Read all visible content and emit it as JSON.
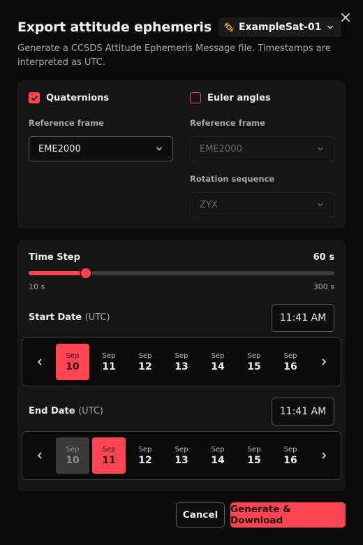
{
  "dialog": {
    "title": "Export attitude ephemeris",
    "satellite": "ExampleSat-01",
    "subtitle": "Generate a CCSDS Attitude Ephemeris Message file. Timestamps are interpreted as UTC."
  },
  "orientation": {
    "quaternions": {
      "label": "Quaternions",
      "checked": true,
      "reference_frame_label": "Reference frame",
      "reference_frame_value": "EME2000"
    },
    "euler": {
      "label": "Euler angles",
      "checked": false,
      "reference_frame_label": "Reference frame",
      "reference_frame_value": "EME2000",
      "rotation_sequence_label": "Rotation sequence",
      "rotation_sequence_value": "ZYX"
    }
  },
  "time_step": {
    "label": "Time Step",
    "value_label": "60 s",
    "value": 60,
    "min": 10,
    "max": 300,
    "min_label": "10 s",
    "max_label": "300 s"
  },
  "start_date": {
    "label": "Start Date",
    "suffix": "(UTC)",
    "time": "11:41 AM",
    "days": [
      {
        "month": "Sep",
        "day": "10",
        "state": "selected"
      },
      {
        "month": "Sep",
        "day": "11",
        "state": "normal"
      },
      {
        "month": "Sep",
        "day": "12",
        "state": "normal"
      },
      {
        "month": "Sep",
        "day": "13",
        "state": "normal"
      },
      {
        "month": "Sep",
        "day": "14",
        "state": "normal"
      },
      {
        "month": "Sep",
        "day": "15",
        "state": "normal"
      },
      {
        "month": "Sep",
        "day": "16",
        "state": "normal"
      }
    ]
  },
  "end_date": {
    "label": "End Date",
    "suffix": "(UTC)",
    "time": "11:41 AM",
    "days": [
      {
        "month": "Sep",
        "day": "10",
        "state": "disabled"
      },
      {
        "month": "Sep",
        "day": "11",
        "state": "selected"
      },
      {
        "month": "Sep",
        "day": "12",
        "state": "normal"
      },
      {
        "month": "Sep",
        "day": "13",
        "state": "normal"
      },
      {
        "month": "Sep",
        "day": "14",
        "state": "normal"
      },
      {
        "month": "Sep",
        "day": "15",
        "state": "normal"
      },
      {
        "month": "Sep",
        "day": "16",
        "state": "normal"
      }
    ]
  },
  "actions": {
    "cancel_label": "Cancel",
    "submit_label": "Generate & Download"
  },
  "icons": {
    "close": "close-icon",
    "satellite": "satellite-icon",
    "chevron": "chevron-down-icon",
    "check": "checkmark-icon",
    "prev": "chevron-left-icon",
    "next": "chevron-right-icon"
  },
  "colors": {
    "accent": "#ff4453",
    "satellite_icon": "#e8a23a",
    "background": "#0b0b0b",
    "panel": "#151515"
  }
}
